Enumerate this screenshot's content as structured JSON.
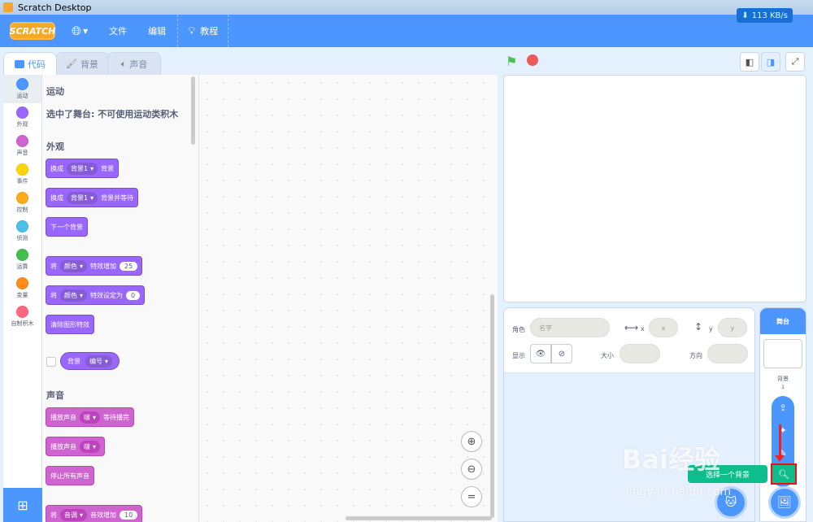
{
  "window": {
    "title": "Scratch Desktop"
  },
  "menubar": {
    "logo": "SCRATCH",
    "file": "文件",
    "edit": "编辑",
    "tutorial": "教程",
    "netspeed": "113 KB/s"
  },
  "tabs": [
    {
      "label": "代码"
    },
    {
      "label": "背景"
    },
    {
      "label": "声音"
    }
  ],
  "categories": [
    {
      "label": "运动",
      "color": "#4c97ff"
    },
    {
      "label": "外观",
      "color": "#9966ff"
    },
    {
      "label": "声音",
      "color": "#cf63cf"
    },
    {
      "label": "事件",
      "color": "#ffd500"
    },
    {
      "label": "控制",
      "color": "#ffab19"
    },
    {
      "label": "侦测",
      "color": "#4cbfe6"
    },
    {
      "label": "运算",
      "color": "#40bf4a"
    },
    {
      "label": "变量",
      "color": "#ff8c1a"
    },
    {
      "label": "自制积木",
      "color": "#ff6680"
    }
  ],
  "palette": {
    "motion_title": "运动",
    "motion_note": "选中了舞台: 不可使用运动类积木",
    "looks_title": "外观",
    "sound_title": "声音",
    "b1": {
      "a": "换成",
      "dd": "背景1",
      "b": "背景"
    },
    "b2": {
      "a": "换成",
      "dd": "背景1",
      "b": "背景并等待"
    },
    "b3": {
      "a": "下一个背景"
    },
    "b4": {
      "a": "将",
      "dd": "颜色",
      "b": "特效增加",
      "num": "25"
    },
    "b5": {
      "a": "将",
      "dd": "颜色",
      "b": "特效设定为",
      "num": "0"
    },
    "b6": {
      "a": "清除图形特效"
    },
    "reporter": {
      "a": "背景",
      "dd": "编号"
    },
    "s1": {
      "a": "播放声音",
      "dd": "啵",
      "b": "等待播完"
    },
    "s2": {
      "a": "播放声音",
      "dd": "啵"
    },
    "s3": {
      "a": "停止所有声音"
    },
    "s4": {
      "a": "将",
      "dd": "音调",
      "b": "音效增加",
      "num": "10"
    }
  },
  "workspace": {
    "zoom_in": "⊕",
    "zoom_out": "⊖",
    "reset": "="
  },
  "sprite_info": {
    "sprite_label": "角色",
    "name_placeholder": "名字",
    "x_label": "x",
    "x_placeholder": "x",
    "y_label": "y",
    "y_placeholder": "y",
    "show_label": "显示",
    "size_label": "大小",
    "direction_label": "方向"
  },
  "stage_pane": {
    "header": "舞台",
    "backdrops_label": "背景",
    "backdrops_count": "1"
  },
  "tooltip": "选择一个背景",
  "watermark": {
    "main": "Bai经验",
    "sub": "jingyan.baidu.com"
  }
}
